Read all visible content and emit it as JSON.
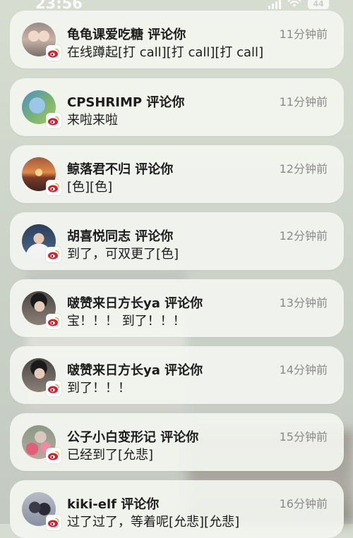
{
  "status_bar": {
    "time": "23:56",
    "battery": "44"
  },
  "notifications": [
    {
      "title": "龟龟课爱吃糖 评论你",
      "message": "在线蹲起[打 call][打 call][打 call]",
      "time": "11分钟前",
      "avatar_icon": "avatar-icon",
      "badge_icon": "weibo-icon"
    },
    {
      "title": "CPSHRIMP 评论你",
      "message": "来啦来啦",
      "time": "11分钟前",
      "avatar_icon": "avatar-icon",
      "badge_icon": "weibo-icon"
    },
    {
      "title": "鲸落君不归 评论你",
      "message": "[色][色]",
      "time": "12分钟前",
      "avatar_icon": "avatar-icon",
      "badge_icon": "weibo-icon"
    },
    {
      "title": "胡喜悦同志 评论你",
      "message": "到了，可双更了[色]",
      "time": "12分钟前",
      "avatar_icon": "avatar-icon",
      "badge_icon": "weibo-icon"
    },
    {
      "title": "啵赞来日方长ya 评论你",
      "message": "宝！！！ 到了！！！",
      "time": "13分钟前",
      "avatar_icon": "avatar-icon",
      "badge_icon": "weibo-icon"
    },
    {
      "title": "啵赞来日方长ya 评论你",
      "message": "到了！！！",
      "time": "14分钟前",
      "avatar_icon": "avatar-icon",
      "badge_icon": "weibo-icon"
    },
    {
      "title": "公子小白变形记 评论你",
      "message": "已经到了[允悲]",
      "time": "15分钟前",
      "avatar_icon": "avatar-icon",
      "badge_icon": "weibo-icon"
    },
    {
      "title": "kiki-elf 评论你",
      "message": "过了过了，等着呢[允悲][允悲]",
      "time": "16分钟前",
      "avatar_icon": "avatar-icon",
      "badge_icon": "weibo-icon"
    }
  ],
  "colors": {
    "card_bg": "#f3f5f0",
    "weibo_red": "#e6162d",
    "weibo_yellow": "#f5a623",
    "time_gray": "#8a8a8a"
  }
}
